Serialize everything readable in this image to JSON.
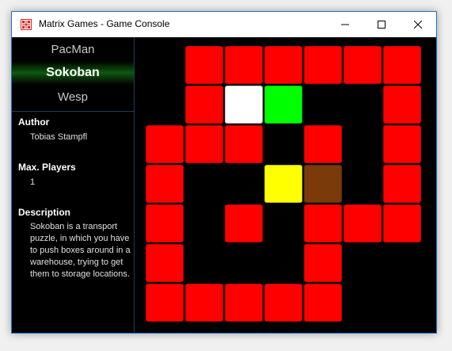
{
  "window": {
    "title": "Matrix Games - Game Console",
    "icon": "matrix-grid-icon",
    "controls": [
      "minimize-icon",
      "maximize-icon",
      "close-icon"
    ]
  },
  "games": [
    {
      "label": "PacMan",
      "selected": false
    },
    {
      "label": "Sokoban",
      "selected": true
    },
    {
      "label": "Wesp",
      "selected": false
    }
  ],
  "details": {
    "author_heading": "Author",
    "author": "Tobias Stampfl",
    "players_heading": "Max. Players",
    "players": "1",
    "description_heading": "Description",
    "description": "Sokoban is a transport puzzle, in which you have to push boxes around in a warehouse, trying to get them to storage locations."
  },
  "board": {
    "colors": {
      "wall": "#ff0000",
      "player": "#ffffff",
      "target": "#00ff00",
      "box": "#ffff00",
      "box_on_spot": "#7a3a0a",
      "empty": "#000000"
    },
    "grid": [
      [
        ".",
        "W",
        "W",
        "W",
        "W",
        "W",
        "W",
        "."
      ],
      [
        ".",
        "W",
        "P",
        "G",
        ".",
        ".",
        "W",
        "."
      ],
      [
        "W",
        "W",
        "W",
        ".",
        "W",
        ".",
        "W",
        "."
      ],
      [
        "W",
        ".",
        ".",
        "Y",
        "B",
        ".",
        "W",
        "."
      ],
      [
        "W",
        ".",
        "W",
        ".",
        "W",
        "W",
        "W",
        "."
      ],
      [
        "W",
        ".",
        ".",
        ".",
        "W",
        ".",
        ".",
        "."
      ],
      [
        "W",
        "W",
        "W",
        "W",
        "W",
        ".",
        ".",
        "."
      ]
    ]
  }
}
